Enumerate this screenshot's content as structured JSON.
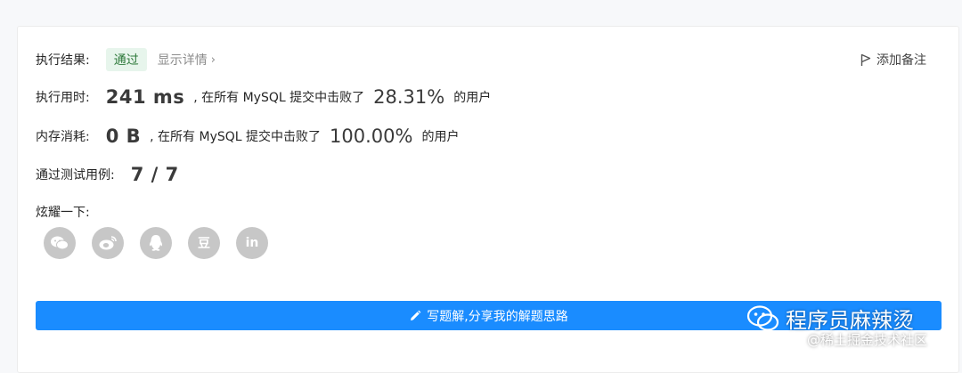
{
  "result": {
    "label": "执行结果:",
    "status": "通过",
    "details": "显示详情",
    "add_note": "添加备注"
  },
  "runtime": {
    "label": "执行用时:",
    "value": "241 ms",
    "prefix": ", 在所有 MySQL 提交中击败了",
    "percent": "28.31%",
    "suffix": "的用户"
  },
  "memory": {
    "label": "内存消耗:",
    "value": "0 B",
    "prefix": ", 在所有 MySQL 提交中击败了",
    "percent": "100.00%",
    "suffix": "的用户"
  },
  "tests": {
    "label": "通过测试用例:",
    "value": "7 / 7"
  },
  "share": {
    "label": "炫耀一下:",
    "icons": [
      "wechat-icon",
      "weibo-icon",
      "qq-icon",
      "douban-icon",
      "linkedin-icon"
    ],
    "douban_glyph": "豆",
    "linkedin_glyph": "in"
  },
  "write_button": "写题解,分享我的解题思路",
  "watermark": {
    "title": "程序员麻辣烫",
    "source": "@稀土掘金技术社区"
  },
  "colors": {
    "accent": "#1a8cff",
    "success_bg": "#e7f5ec",
    "success_text": "#2f7a3c",
    "icon_gray": "#c7c7c7"
  }
}
